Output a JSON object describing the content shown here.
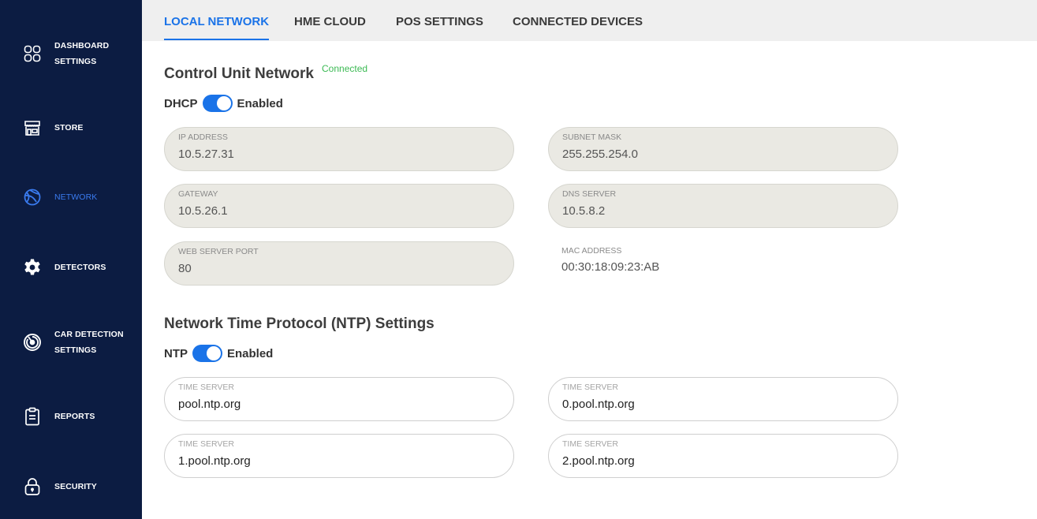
{
  "sidebar": {
    "items": [
      {
        "label_line1": "DASHBOARD",
        "label_line2": "SETTINGS",
        "icon": "dashboard-grid-icon"
      },
      {
        "label_line1": "STORE",
        "label_line2": "",
        "icon": "store-icon"
      },
      {
        "label_line1": "NETWORK",
        "label_line2": "",
        "icon": "network-globe-icon",
        "active": true
      },
      {
        "label_line1": "DETECTORS",
        "label_line2": "",
        "icon": "gear-icon"
      },
      {
        "label_line1": "CAR DETECTION",
        "label_line2": "SETTINGS",
        "icon": "radar-icon"
      },
      {
        "label_line1": "REPORTS",
        "label_line2": "",
        "icon": "clipboard-icon"
      },
      {
        "label_line1": "SECURITY",
        "label_line2": "",
        "icon": "lock-icon"
      }
    ]
  },
  "tabs": [
    {
      "label": "LOCAL NETWORK",
      "active": true
    },
    {
      "label": "HME CLOUD"
    },
    {
      "label": "POS SETTINGS"
    },
    {
      "label": "CONNECTED DEVICES"
    }
  ],
  "control_unit": {
    "title": "Control Unit Network",
    "status": "Connected",
    "dhcp": {
      "label": "DHCP",
      "state": "Enabled"
    },
    "fields": {
      "ip": {
        "label": "IP ADDRESS",
        "value": "10.5.27.31"
      },
      "subnet": {
        "label": "SUBNET MASK",
        "value": "255.255.254.0"
      },
      "gateway": {
        "label": "GATEWAY",
        "value": "10.5.26.1"
      },
      "dns": {
        "label": "DNS SERVER",
        "value": "10.5.8.2"
      },
      "port": {
        "label": "WEB SERVER PORT",
        "value": "80"
      },
      "mac": {
        "label": "MAC ADDRESS",
        "value": "00:30:18:09:23:AB"
      }
    }
  },
  "ntp": {
    "title": "Network Time Protocol (NTP) Settings",
    "toggle": {
      "label": "NTP",
      "state": "Enabled"
    },
    "servers": [
      {
        "label": "TIME SERVER",
        "value": "pool.ntp.org"
      },
      {
        "label": "TIME SERVER",
        "value": "0.pool.ntp.org"
      },
      {
        "label": "TIME SERVER",
        "value": "1.pool.ntp.org"
      },
      {
        "label": "TIME SERVER",
        "value": "2.pool.ntp.org"
      }
    ]
  },
  "colors": {
    "sidebar_bg": "#0c1c42",
    "accent": "#1a73e8",
    "connected": "#3cba54",
    "field_bg": "#eae9e3"
  }
}
